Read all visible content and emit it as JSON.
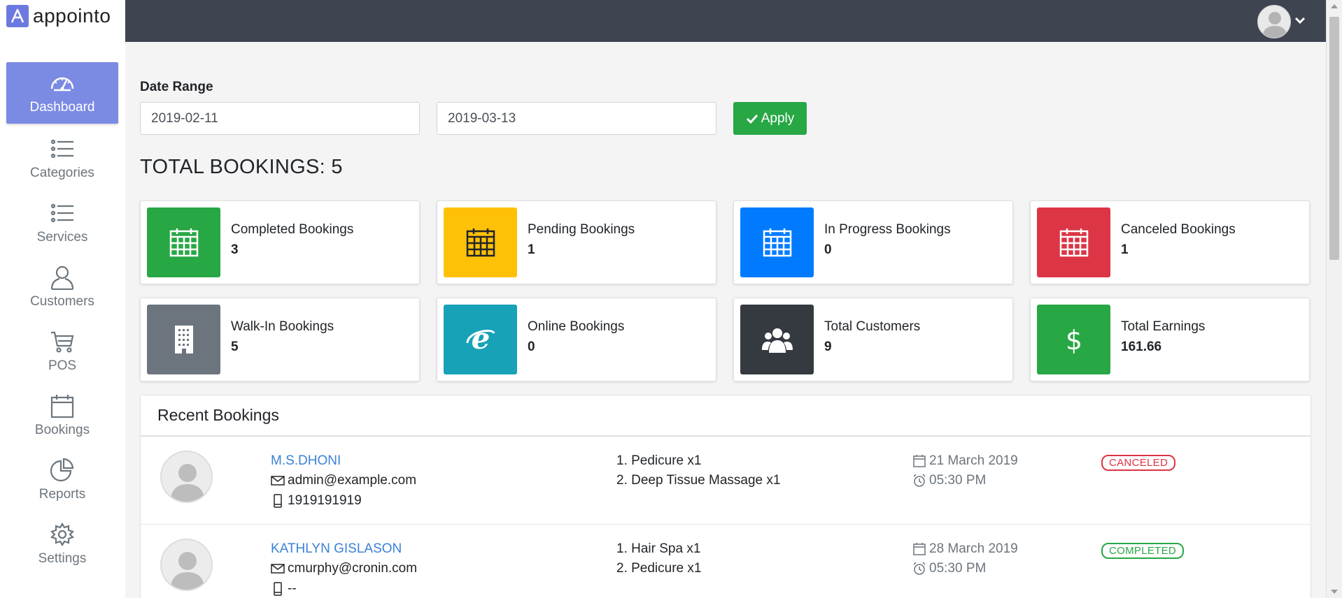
{
  "brand": {
    "name": "appointo",
    "color": "#6c7ae0"
  },
  "sidebar": {
    "items": [
      {
        "label": "Dashboard",
        "icon": "dashboard-icon",
        "active": true
      },
      {
        "label": "Categories",
        "icon": "list-icon"
      },
      {
        "label": "Services",
        "icon": "list-icon"
      },
      {
        "label": "Customers",
        "icon": "user-icon"
      },
      {
        "label": "POS",
        "icon": "cart-icon"
      },
      {
        "label": "Bookings",
        "icon": "calendar-icon"
      },
      {
        "label": "Reports",
        "icon": "pie-chart-icon"
      },
      {
        "label": "Settings",
        "icon": "gear-icon"
      }
    ]
  },
  "filter": {
    "label": "Date Range",
    "start": "2019-02-11",
    "end": "2019-03-13",
    "apply_label": "Apply"
  },
  "total_bookings": "TOTAL BOOKINGS: 5",
  "stats": [
    {
      "title": "Completed Bookings",
      "value": "3",
      "color": "#28a745",
      "icon": "calendar-icon"
    },
    {
      "title": "Pending Bookings",
      "value": "1",
      "color": "#ffc107",
      "icon": "calendar-icon"
    },
    {
      "title": "In Progress Bookings",
      "value": "0",
      "color": "#007bff",
      "icon": "calendar-icon"
    },
    {
      "title": "Canceled Bookings",
      "value": "1",
      "color": "#dc3545",
      "icon": "calendar-icon"
    },
    {
      "title": "Walk-In Bookings",
      "value": "5",
      "color": "#6c757d",
      "icon": "building-icon"
    },
    {
      "title": "Online Bookings",
      "value": "0",
      "color": "#17a2b8",
      "icon": "internet-explorer-icon"
    },
    {
      "title": "Total Customers",
      "value": "9",
      "color": "#343a40",
      "icon": "users-icon"
    },
    {
      "title": "Total Earnings",
      "value": "161.66",
      "color": "#28a745",
      "icon": "dollar-icon"
    }
  ],
  "recent": {
    "title": "Recent Bookings",
    "bookings": [
      {
        "name": "M.S.DHONI",
        "email": "admin@example.com",
        "phone": "1919191919",
        "services": [
          "1. Pedicure x1",
          "2. Deep Tissue Massage x1"
        ],
        "date": "21 March 2019",
        "time": "05:30 PM",
        "status": "CANCELED"
      },
      {
        "name": "KATHLYN GISLASON",
        "email": "cmurphy@cronin.com",
        "phone": "--",
        "services": [
          "1. Hair Spa x1",
          "2. Pedicure x1"
        ],
        "date": "28 March 2019",
        "time": "05:30 PM",
        "status": "COMPLETED"
      }
    ]
  }
}
